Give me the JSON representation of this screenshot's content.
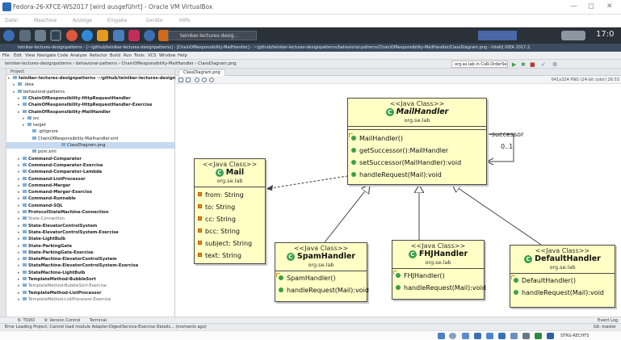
{
  "vbox": {
    "title": "Fedora-26-XFCE-WS2017 [wird ausgeführt] - Oracle VM VirtualBox",
    "menu": [
      "Datei",
      "Maschine",
      "Anzeige",
      "Eingabe",
      "Geräte",
      "Hilfe"
    ],
    "minimize": "—",
    "maximize": "◻",
    "close": "✕",
    "host_key": "STRG-RECHTS"
  },
  "xfce": {
    "task_label": "teiniker-lectures-desig...",
    "clock": "17:0"
  },
  "ide": {
    "title": "teiniker-lectures-designpatterns - [~/github/teiniker-lectures-designpatterns] - [ChainOfResponsibility-MailHandler] - ~/github/teiniker-lectures-designpatterns/behavioral-patterns/ChainOfResponsibility-MailHandler/ClassDiagram.png - IntelliJ IDEA 2017.2.",
    "menu": [
      "File",
      "Edit",
      "View",
      "Navigate",
      "Code",
      "Analyze",
      "Refactor",
      "Build",
      "Run",
      "Tools",
      "VCS",
      "Window",
      "Help"
    ],
    "breadcrumb": "teiniker-lectures-designpatterns › behavioral-patterns › ChainOfResponsibility-MailHandler › ClassDiagram.png",
    "run_config": "org.se.lab in CoR-OrderService",
    "project_header": "Project",
    "tree": [
      {
        "label": "teiniker-lectures-designpatterns ~/github/teiniker-lectures-designpatterns",
        "d": 0,
        "b": true
      },
      {
        "label": ".idea",
        "d": 1
      },
      {
        "label": "behavioral-patterns",
        "d": 1
      },
      {
        "label": "ChainOfResponsibility-HttpRequestHandler",
        "d": 2,
        "b": true
      },
      {
        "label": "ChainOfResponsibility-HttpRequestHandler-Exercise",
        "d": 2,
        "b": true
      },
      {
        "label": "ChainOfResponsibility-MailHandler",
        "d": 2,
        "b": true
      },
      {
        "label": "src",
        "d": 3
      },
      {
        "label": "target",
        "d": 3
      },
      {
        "label": ".gitignore",
        "d": 4
      },
      {
        "label": "ChainOfResponsibility-Mailhandler.xml",
        "d": 4
      },
      {
        "label": "ClassDiagram.png",
        "d": 4,
        "sel": true
      },
      {
        "label": "pom.xml",
        "d": 4
      },
      {
        "label": "Command-Comparator",
        "d": 2,
        "b": true
      },
      {
        "label": "Command-Comparator-Exercise",
        "d": 2,
        "b": true
      },
      {
        "label": "Command-Comparator-Lambda",
        "d": 2,
        "b": true
      },
      {
        "label": "Command-ListProcessor",
        "d": 2,
        "b": true
      },
      {
        "label": "Command-Merger",
        "d": 2,
        "b": true
      },
      {
        "label": "Command-Merger-Exercise",
        "d": 2,
        "b": true
      },
      {
        "label": "Command-Runnable",
        "d": 2,
        "b": true
      },
      {
        "label": "Command-SQL",
        "d": 2,
        "b": true
      },
      {
        "label": "ProtocolStateMachine-Connection",
        "d": 2,
        "b": true
      },
      {
        "label": "State-Connection",
        "d": 2,
        "g": true
      },
      {
        "label": "State-ElevatorControlSystem",
        "d": 2,
        "b": true
      },
      {
        "label": "State-ElevatorControlSystem-Exercise",
        "d": 2,
        "b": true
      },
      {
        "label": "State-LightBulb",
        "d": 2,
        "b": true
      },
      {
        "label": "State-ParkingGate",
        "d": 2,
        "b": true
      },
      {
        "label": "State-ParkingGate-Exercise",
        "d": 2,
        "b": true
      },
      {
        "label": "StateMachine-ElevatorControlSystem",
        "d": 2,
        "b": true
      },
      {
        "label": "StateMachine-ElevatorControlSystem-Exercise",
        "d": 2,
        "b": true
      },
      {
        "label": "StateMachine-LightBulb",
        "d": 2,
        "b": true
      },
      {
        "label": "TemplateMethod-BubbleSort",
        "d": 2,
        "b": true
      },
      {
        "label": "TemplateMethod-BubbleSort-Exercise",
        "d": 2,
        "g": true
      },
      {
        "label": "TemplateMethod-ListProcessor",
        "d": 2,
        "b": true
      },
      {
        "label": "TemplateMethod-ListProcessor-Exercise",
        "d": 2,
        "g": true
      }
    ],
    "editor_tab": "ClassDiagram.png",
    "image_info": "641x324 PNG (24-bit color) 26.53",
    "bottom_tools": [
      "6: TODO",
      "9: Version Control",
      "Terminal"
    ],
    "status": "Error Loading Project: Cannot load module Adapter-DigestService-Exercise Details... (moments ago)",
    "status_right": "Git: master",
    "event_log": "Event Log"
  },
  "diagram": {
    "stereotype": "<<Java Class>>",
    "package": "org.se.lab",
    "assoc_role": "-successor",
    "assoc_mult": "0..1",
    "mailhandler": {
      "name": "MailHandler",
      "methods": [
        "MailHandler()",
        "getSuccessor():MailHandler",
        "setSuccessor(MailHandler):void",
        "handleRequest(Mail):void"
      ]
    },
    "mail": {
      "name": "Mail",
      "fields": [
        "from: String",
        "to: String",
        "cc: String",
        "bcc: String",
        "subject: String",
        "text: String"
      ]
    },
    "spam": {
      "name": "SpamHandler",
      "methods": [
        "SpamHandler()",
        "handleRequest(Mail):void"
      ]
    },
    "fhj": {
      "name": "FHJHandler",
      "methods": [
        "FHJHandler()",
        "handleRequest(Mail):void"
      ]
    },
    "default": {
      "name": "DefaultHandler",
      "methods": [
        "DefaultHandler()",
        "handleRequest(Mail):void"
      ]
    }
  }
}
